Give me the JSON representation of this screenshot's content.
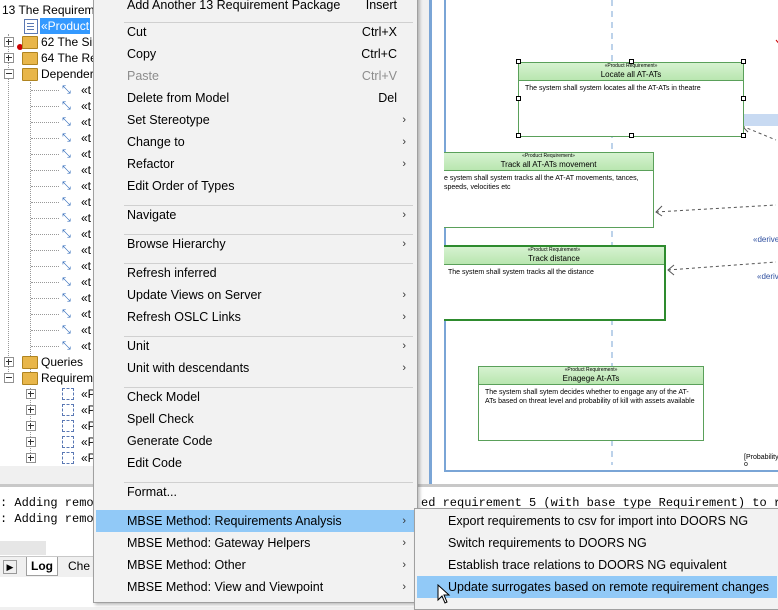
{
  "tree": {
    "rows": [
      {
        "label": "13 The Requirem",
        "indent": 0
      },
      {
        "label": "«Product",
        "selected": true
      },
      {
        "label": "62 The Sir"
      },
      {
        "label": "64 The Re"
      },
      {
        "label": "Depender"
      },
      {
        "label": "«t"
      },
      {
        "label": "«t"
      },
      {
        "label": "«t"
      },
      {
        "label": "«t"
      },
      {
        "label": "«t"
      },
      {
        "label": "«t"
      },
      {
        "label": "«t"
      },
      {
        "label": "«t"
      },
      {
        "label": "«t"
      },
      {
        "label": "«t"
      },
      {
        "label": "«t"
      },
      {
        "label": "«t"
      },
      {
        "label": "«t"
      },
      {
        "label": "«t"
      },
      {
        "label": "«t"
      },
      {
        "label": "«t"
      },
      {
        "label": "«t"
      },
      {
        "label": "Queries"
      },
      {
        "label": "Requirem"
      },
      {
        "label": "«P"
      },
      {
        "label": "«P"
      },
      {
        "label": "«P"
      },
      {
        "label": "«P"
      },
      {
        "label": "«P"
      }
    ]
  },
  "menu": {
    "items": [
      {
        "label": "Add Another 13 Requirement Package",
        "shortcut": "Insert"
      },
      {
        "label": "Cut",
        "shortcut": "Ctrl+X"
      },
      {
        "label": "Copy",
        "shortcut": "Ctrl+C"
      },
      {
        "label": "Paste",
        "shortcut": "Ctrl+V",
        "disabled": true
      },
      {
        "label": "Delete from Model",
        "shortcut": "Del"
      },
      {
        "label": "Set Stereotype",
        "submenu": true
      },
      {
        "label": "Change to",
        "submenu": true
      },
      {
        "label": "Refactor",
        "submenu": true
      },
      {
        "label": "Edit Order of Types"
      },
      {
        "label": "Navigate",
        "submenu": true
      },
      {
        "label": "Browse Hierarchy",
        "submenu": true
      },
      {
        "label": "Refresh inferred"
      },
      {
        "label": "Update Views on Server",
        "submenu": true
      },
      {
        "label": "Refresh OSLC Links",
        "submenu": true
      },
      {
        "label": "Unit",
        "submenu": true
      },
      {
        "label": "Unit with descendants",
        "submenu": true
      },
      {
        "label": "Check Model"
      },
      {
        "label": "Spell Check"
      },
      {
        "label": "Generate Code"
      },
      {
        "label": "Edit Code"
      },
      {
        "label": "Format..."
      },
      {
        "label": "MBSE Method: Requirements Analysis",
        "submenu": true,
        "highlighted": true
      },
      {
        "label": "MBSE Method: Gateway Helpers",
        "submenu": true
      },
      {
        "label": "MBSE Method: Other",
        "submenu": true
      },
      {
        "label": "MBSE Method: View and Viewpoint",
        "submenu": true
      }
    ],
    "submenu_arrow": "›"
  },
  "submenu": {
    "items": [
      {
        "label": "Export requirements to csv for import into DOORS NG"
      },
      {
        "label": "Switch requirements to DOORS NG"
      },
      {
        "label": "Establish trace relations to DOORS NG equivalent"
      },
      {
        "label": "Update surrogates based on remote requirement changes",
        "highlighted": true
      }
    ]
  },
  "diagram": {
    "stereotype": "«Product Requirement»",
    "boxes": [
      {
        "title": "Locate all AT-ATs",
        "text": "The system shall system locates all the AT-ATs in theatre"
      },
      {
        "title": "Track all AT-ATs movement",
        "text": "e system shall system tracks all the AT-AT movements, tances, speeds, velocities etc"
      },
      {
        "title": "Track distance",
        "text": "The system shall system tracks all the distance"
      },
      {
        "title": "Enagege At-ATs",
        "text": "The system shall sytem decides whether to engage any of the AT-ATs based on  threat level and probability of kill with assets available"
      }
    ],
    "derive_label": "«derive",
    "prob_label": "[Probability o"
  },
  "log": {
    "lines": [
      ": Adding remo",
      ": Adding remo"
    ],
    "right_text": "ed requirement 5 (with base type Requirement) to re",
    "tabs": [
      {
        "label": "Log",
        "active": true
      },
      {
        "label": "Che"
      }
    ]
  },
  "colors": {
    "menu_highlight": "#91c9f7",
    "selection": "#3399ff",
    "frame_blue": "#7aa5d6",
    "req_border": "#5aa05a"
  }
}
